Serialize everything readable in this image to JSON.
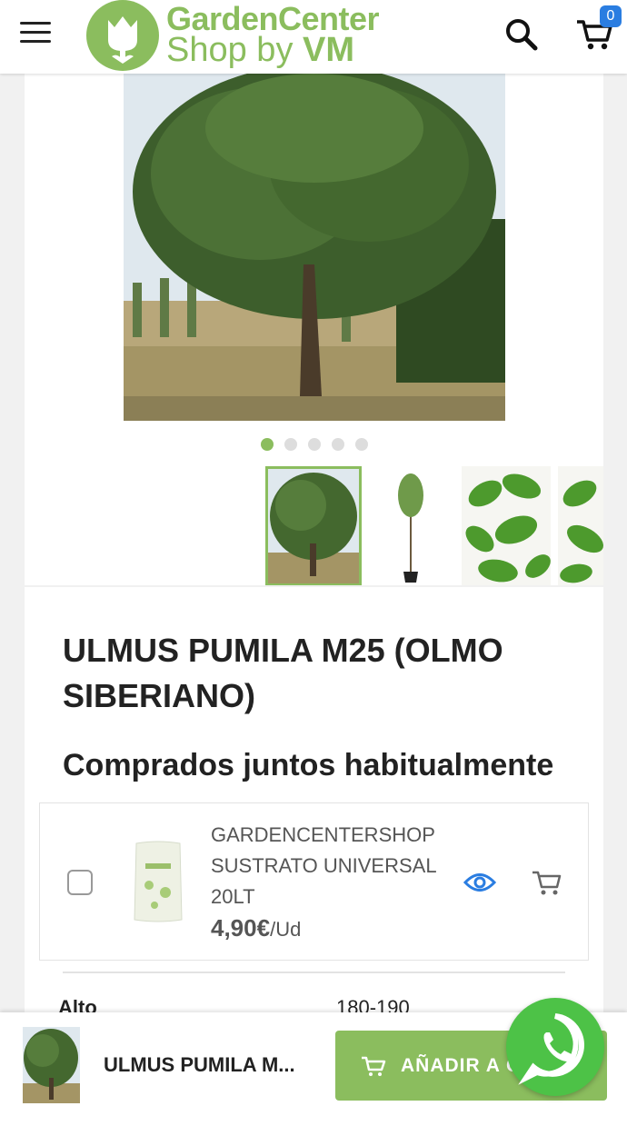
{
  "header": {
    "logo": {
      "line1": "GardenCenter",
      "line2_prefix": "Shop by ",
      "line2_bold": "VM"
    },
    "cart_count": "0"
  },
  "gallery": {
    "dots_count": 5,
    "active_dot": 0
  },
  "product": {
    "title": "ULMUS PUMILA M25 (OLMO SIBERIANO)"
  },
  "bought_together": {
    "heading": "Comprados juntos habitualmente",
    "item": {
      "name": "GARDENCENTERSHOP SUSTRATO UNIVERSAL 20LT",
      "price": "4,90€",
      "unit": "/Ud"
    }
  },
  "specs": {
    "label": "Alto",
    "value": "180-190"
  },
  "sticky_bar": {
    "name": "ULMUS PUMILA M...",
    "button_label": "AÑADIR A CARRITO"
  },
  "colors": {
    "brand_green": "#8bbd5e",
    "badge_blue": "#2a7de1",
    "whatsapp_green": "#4dc247"
  }
}
